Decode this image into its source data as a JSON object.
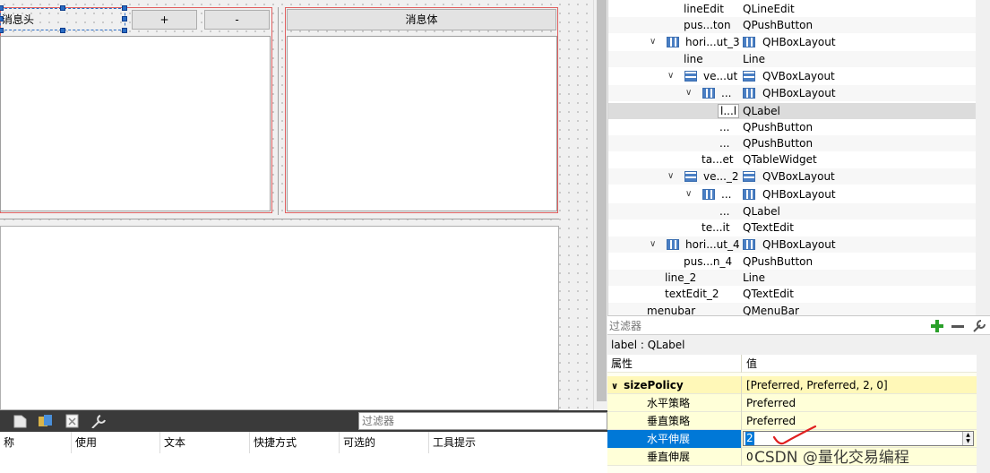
{
  "canvas": {
    "header_label": "消息头",
    "plus_button": "+",
    "minus_button": "-",
    "body_button": "消息体"
  },
  "tree": {
    "rows": [
      {
        "name": "lineEdit",
        "class": "QLineEdit"
      },
      {
        "name": "pus...ton",
        "class": "QPushButton"
      },
      {
        "name": "hori...ut_3",
        "class": "QHBoxLayout"
      },
      {
        "name": "line",
        "class": "Line"
      },
      {
        "name": "ve...ut",
        "class": "QVBoxLayout"
      },
      {
        "name": "...",
        "class": "QHBoxLayout"
      },
      {
        "name": "l...l",
        "class": "QLabel"
      },
      {
        "name": "...",
        "class": "QPushButton"
      },
      {
        "name": "...",
        "class": "QPushButton"
      },
      {
        "name": "ta...et",
        "class": "QTableWidget"
      },
      {
        "name": "ve..._2",
        "class": "QVBoxLayout"
      },
      {
        "name": "...",
        "class": "QHBoxLayout"
      },
      {
        "name": "...",
        "class": "QLabel"
      },
      {
        "name": "te...it",
        "class": "QTextEdit"
      },
      {
        "name": "hori...ut_4",
        "class": "QHBoxLayout"
      },
      {
        "name": "pus...n_4",
        "class": "QPushButton"
      },
      {
        "name": "line_2",
        "class": "Line"
      },
      {
        "name": "textEdit_2",
        "class": "QTextEdit"
      },
      {
        "name": "menubar",
        "class": "QMenuBar"
      }
    ]
  },
  "property_editor": {
    "filter_placeholder": "过滤器",
    "object_label": "label : QLabel",
    "col_property": "属性",
    "col_value": "值",
    "group_name": "sizePolicy",
    "group_value": "[Preferred, Preferred, 2, 0]",
    "rows": [
      {
        "name": "水平策略",
        "value": "Preferred"
      },
      {
        "name": "垂直策略",
        "value": "Preferred"
      },
      {
        "name": "水平伸展",
        "value": "2"
      },
      {
        "name": "垂直伸展",
        "value": "0"
      }
    ]
  },
  "action_editor": {
    "filter_placeholder": "过滤器",
    "columns": [
      "称",
      "使用",
      "文本",
      "快捷方式",
      "可选的",
      "工具提示"
    ]
  },
  "watermark": "CSDN @量化交易编程",
  "colors": {
    "selection": "#0078d7",
    "layout_red": "#e06060",
    "property_yellow": "#ffffd8",
    "add_green": "#2aa02a"
  },
  "icons": [
    "plus-icon",
    "minus-icon",
    "wrench-icon",
    "hbox-layout-icon",
    "vbox-layout-icon",
    "open-icon",
    "new-icon",
    "delete-icon",
    "settings-wrench-icon"
  ]
}
